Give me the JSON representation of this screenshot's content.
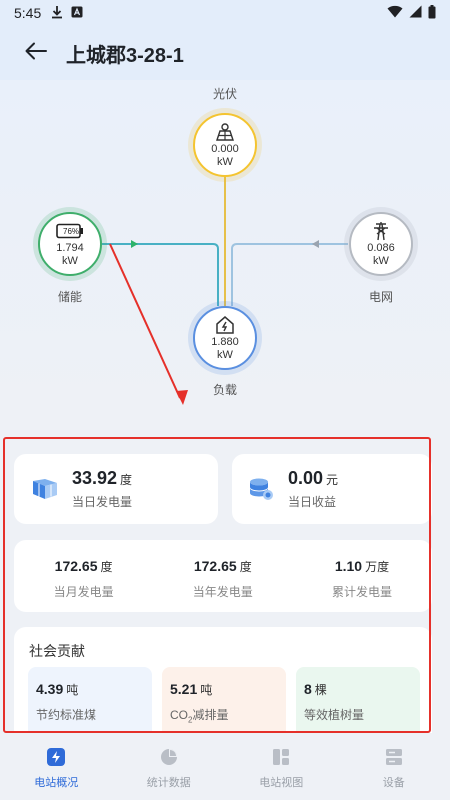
{
  "status_bar": {
    "time": "5:45"
  },
  "header": {
    "title": "上城郡3-28-1"
  },
  "flow": {
    "pv": {
      "label": "光伏",
      "value": "0.000",
      "unit": "kW"
    },
    "battery": {
      "label": "储能",
      "value": "1.794",
      "unit": "kW",
      "soc": "76%"
    },
    "grid": {
      "label": "电网",
      "value": "0.086",
      "unit": "kW"
    },
    "load": {
      "label": "负载",
      "value": "1.880",
      "unit": "kW"
    }
  },
  "day": {
    "value": "33.92",
    "unit": "度",
    "label": "当日发电量"
  },
  "income": {
    "value": "0.00",
    "unit": "元",
    "label": "当日收益"
  },
  "stats": [
    {
      "value": "172.65",
      "unit": "度",
      "label": "当月发电量"
    },
    {
      "value": "172.65",
      "unit": "度",
      "label": "当年发电量"
    },
    {
      "value": "1.10",
      "unit": "万度",
      "label": "累计发电量"
    }
  ],
  "social": {
    "title": "社会贡献",
    "items": [
      {
        "value": "4.39",
        "unit": "吨",
        "label": "节约标准煤"
      },
      {
        "value": "5.21",
        "unit": "吨",
        "label_prefix": "CO",
        "label_sub": "2",
        "label_suffix": "减排量"
      },
      {
        "value": "8",
        "unit": "棵",
        "label": "等效植树量"
      }
    ]
  },
  "nav": {
    "tabs": [
      {
        "label": "电站概况",
        "icon": "lightning-icon"
      },
      {
        "label": "统计数据",
        "icon": "pie-chart-icon"
      },
      {
        "label": "电站视图",
        "icon": "grid-view-icon"
      },
      {
        "label": "设备",
        "icon": "device-icon"
      }
    ]
  },
  "colors": {
    "accent": "#2f6bd8",
    "pv": "#f4c430",
    "battery": "#3fae6b",
    "grid": "#b5bac2",
    "load": "#5a8fe0",
    "annotation": "#e5302a"
  }
}
